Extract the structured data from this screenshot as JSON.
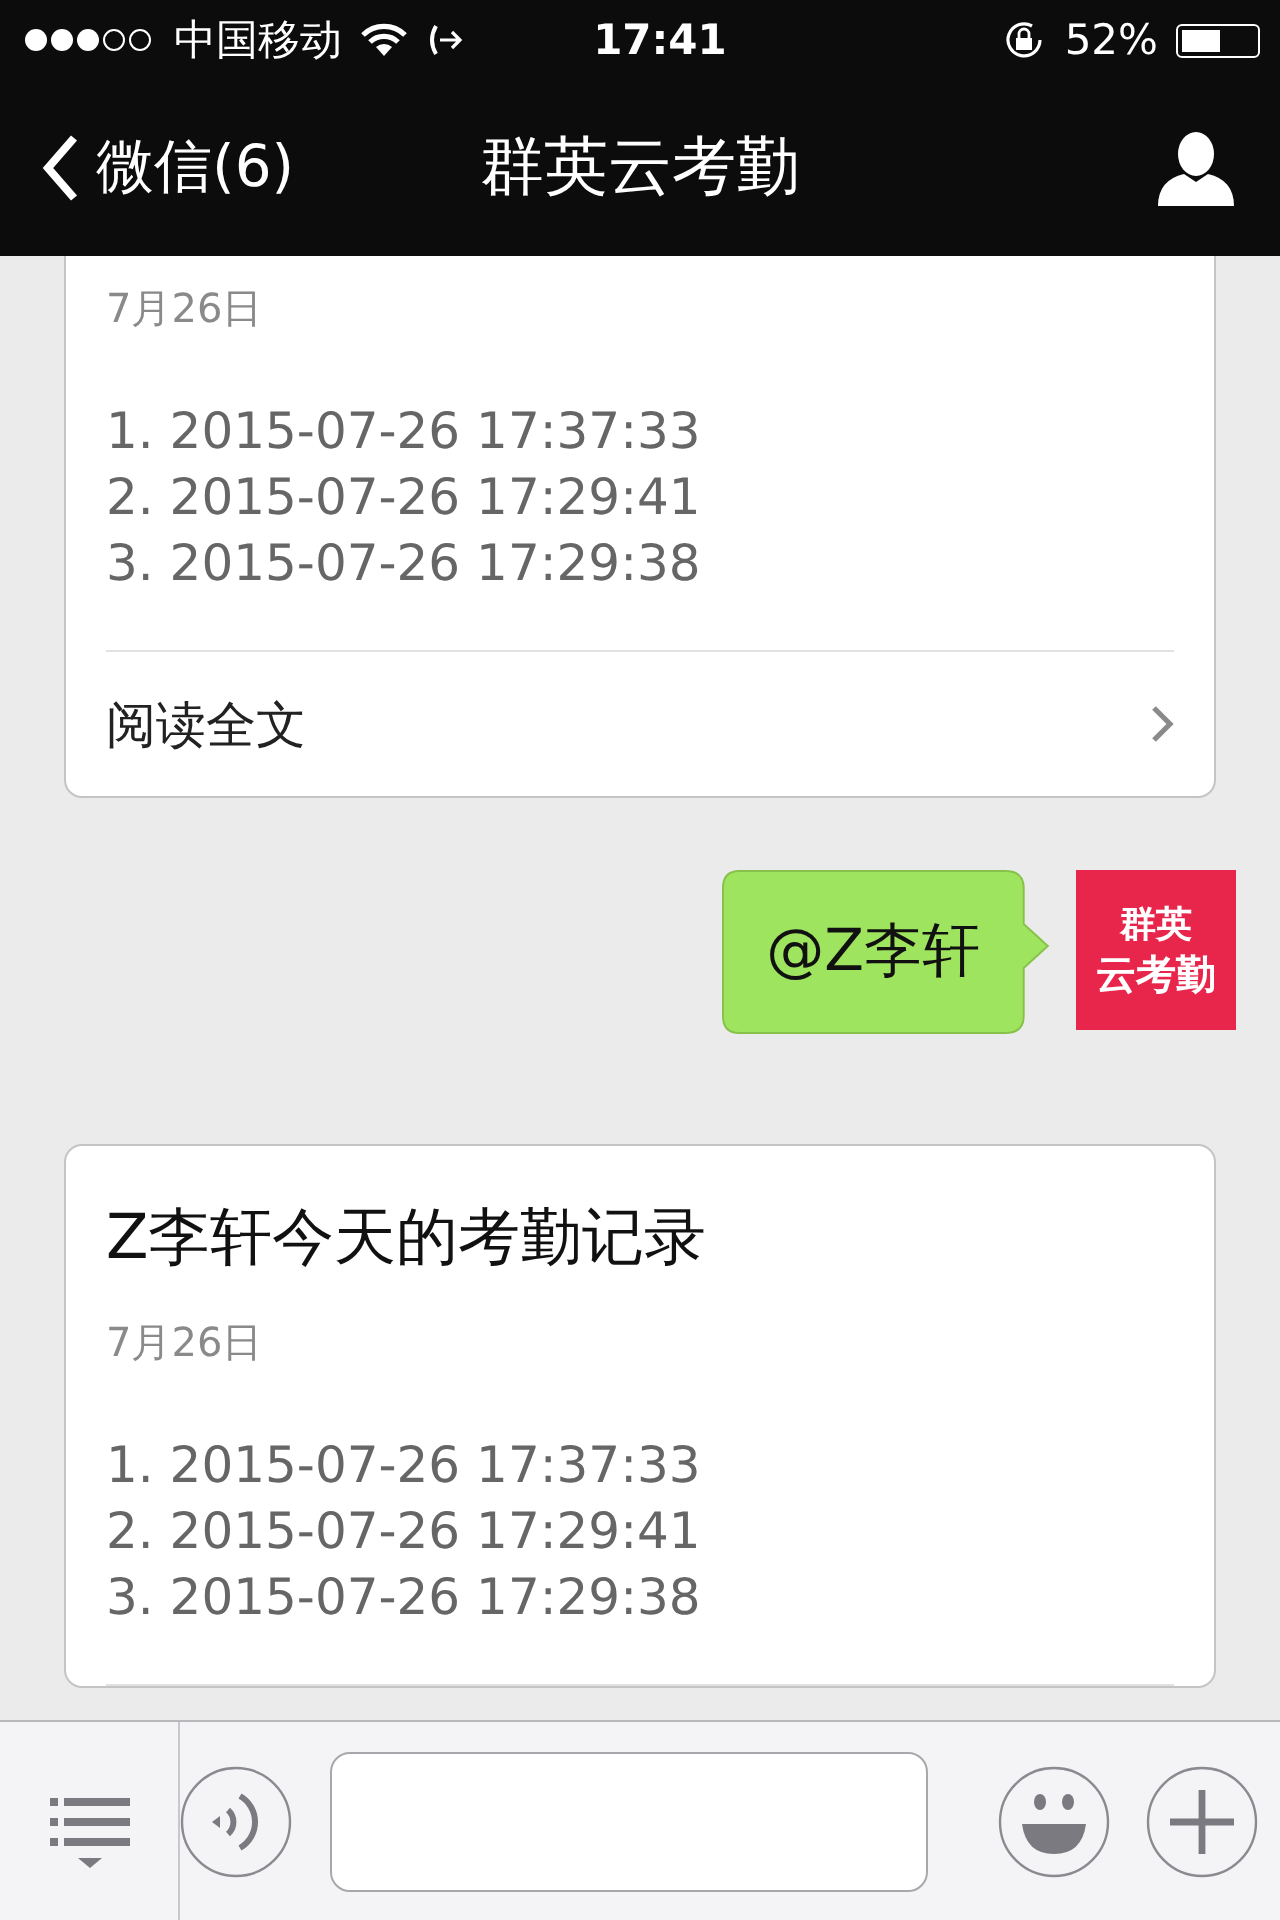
{
  "status_bar": {
    "carrier": "中国移动",
    "time": "17:41",
    "battery": "52%"
  },
  "nav": {
    "back": "微信(6)",
    "title": "群英云考勤"
  },
  "messages": [
    {
      "kind": "article",
      "date": "7月26日",
      "lines": [
        "1. 2015-07-26 17:37:33",
        "2. 2015-07-26 17:29:41",
        "3. 2015-07-26 17:29:38"
      ],
      "read_more": "阅读全文"
    },
    {
      "kind": "text",
      "text": "@Z李轩",
      "avatar": [
        "群英",
        "云考勤"
      ]
    },
    {
      "kind": "article",
      "title": "Z李轩今天的考勤记录",
      "date": "7月26日",
      "lines": [
        "1. 2015-07-26 17:37:33",
        "2. 2015-07-26 17:29:41",
        "3. 2015-07-26 17:29:38"
      ]
    }
  ]
}
